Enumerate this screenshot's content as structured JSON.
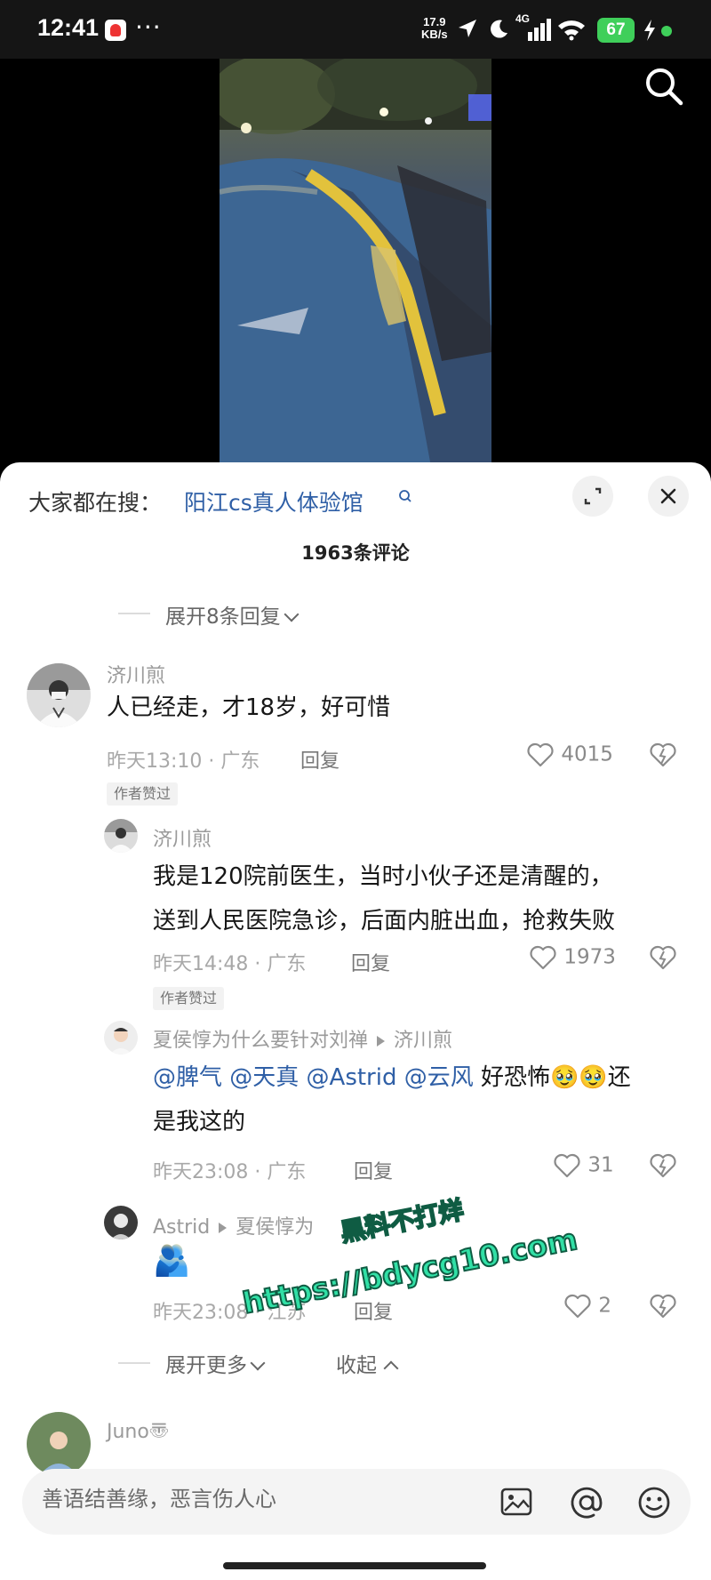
{
  "status_bar": {
    "time": "12:41",
    "more": "···",
    "net_speed_value": "17.9",
    "net_speed_unit": "KB/s",
    "signal_label": "4G",
    "battery": "67"
  },
  "sheet": {
    "trending_label": "大家都在搜：",
    "trending_query": "阳江cs真人体验馆",
    "comment_count": "1963条评论",
    "top_expand": "展开8条回复"
  },
  "comments": [
    {
      "user": "济川煎",
      "text": "人已经走，才18岁，好可惜",
      "time_loc": "昨天13:10 · 广东",
      "reply": "回复",
      "likes": "4015",
      "badge": "作者赞过"
    },
    {
      "user": "济川煎",
      "text_line1": "我是120院前医生，当时小伙子还是清醒的，",
      "text_line2": "送到人民医院急诊，后面内脏出血，抢救失败",
      "time_loc": "昨天14:48 · 广东",
      "reply": "回复",
      "likes": "1973",
      "badge": "作者赞过"
    },
    {
      "user": "夏侯惇为什么要针对刘禅",
      "reply_to": "济川煎",
      "mentions": "@脾气 @天真 @Astrid @云风",
      "text_line1_tail": " 好恐怖",
      "text_line1_end": "还",
      "text_line2": "是我这的",
      "emoji": "🥹🥹",
      "time_loc": "昨天23:08 · 广东",
      "reply": "回复",
      "likes": "31"
    },
    {
      "user": "Astrid",
      "reply_to": "夏侯惇为",
      "emoji": "🫂",
      "time_loc": "昨天23:08 · 江苏",
      "reply": "回复",
      "likes": "2"
    },
    {
      "user": "Juno〠"
    }
  ],
  "thread_controls": {
    "expand_more": "展开更多",
    "collapse": "收起"
  },
  "watermark": {
    "line1": "黑料不打烊",
    "line2": "https://bdycg10.com"
  },
  "input": {
    "placeholder": "善语结善缘，恶言伤人心"
  },
  "icons": [
    "search-icon",
    "expand-icon",
    "close-icon",
    "heart-icon",
    "dislike-heart-icon",
    "image-icon",
    "at-icon",
    "emoji-icon"
  ]
}
